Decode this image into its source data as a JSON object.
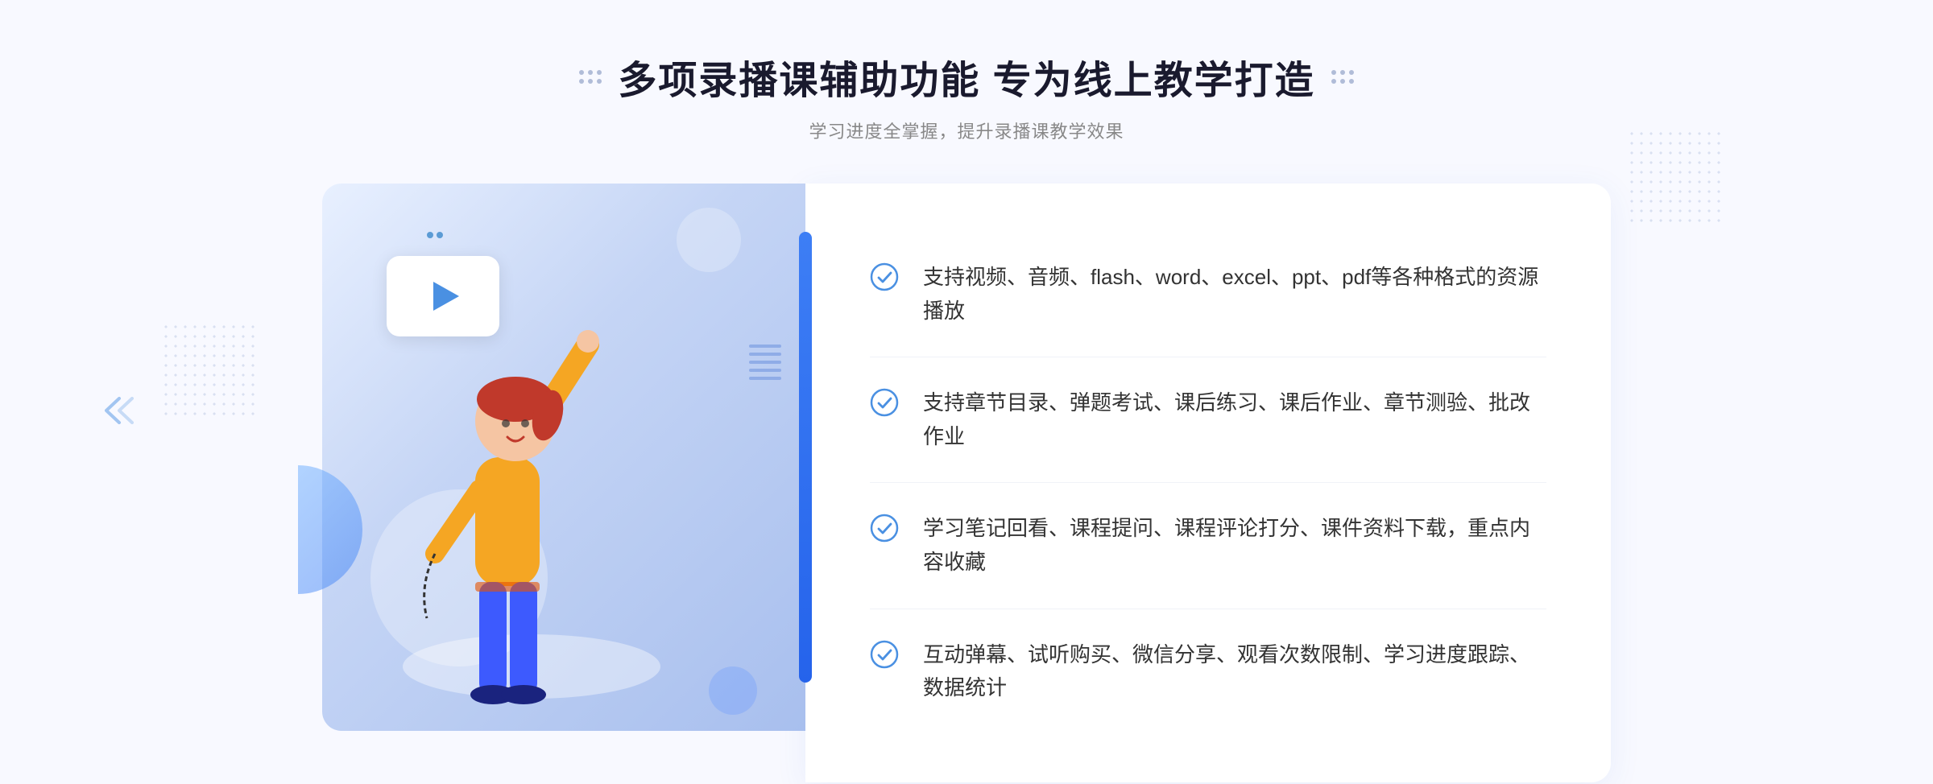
{
  "page": {
    "background_color": "#f8f9ff"
  },
  "header": {
    "main_title": "多项录播课辅助功能 专为线上教学打造",
    "sub_title": "学习进度全掌握，提升录播课教学效果"
  },
  "features": [
    {
      "id": 1,
      "text": "支持视频、音频、flash、word、excel、ppt、pdf等各种格式的资源播放"
    },
    {
      "id": 2,
      "text": "支持章节目录、弹题考试、课后练习、课后作业、章节测验、批改作业"
    },
    {
      "id": 3,
      "text": "学习笔记回看、课程提问、课程评论打分、课件资料下载，重点内容收藏"
    },
    {
      "id": 4,
      "text": "互动弹幕、试听购买、微信分享、观看次数限制、学习进度跟踪、数据统计"
    }
  ],
  "icons": {
    "check_color": "#4a90e2",
    "play_color": "#4a90e2",
    "chevron_color": "#4a90e2"
  }
}
